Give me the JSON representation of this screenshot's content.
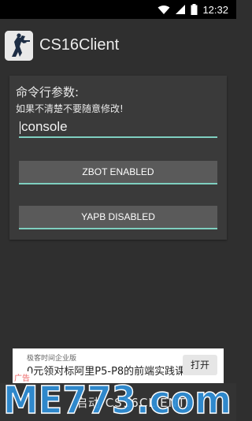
{
  "status_bar": {
    "time": "12:32",
    "icons": [
      "wifi-icon",
      "signal-icon",
      "battery-icon"
    ]
  },
  "app_bar": {
    "title": "CS16Client",
    "logo_icon": "counter-strike-logo"
  },
  "settings": {
    "label_main": "命令行参数:",
    "label_sub": "如果不清楚不要随意修改!",
    "command_value": "console",
    "zbot_button": "ZBOT ENABLED",
    "yapb_button": "YAPB DISABLED"
  },
  "ad": {
    "source": "极客时间企业版",
    "text": "0元领对标阿里P5-P8的前端实践课",
    "open_label": "打开",
    "badge": "广告"
  },
  "bottom": {
    "launch_text": "启动 CS16CLIENT!",
    "watermark": "ME773.com"
  },
  "colors": {
    "accent": "#7fcfc0",
    "background": "#2f2f2f",
    "panel": "#3a3a3a",
    "button": "#5a5a5a",
    "watermark": "#2f8fd8"
  }
}
